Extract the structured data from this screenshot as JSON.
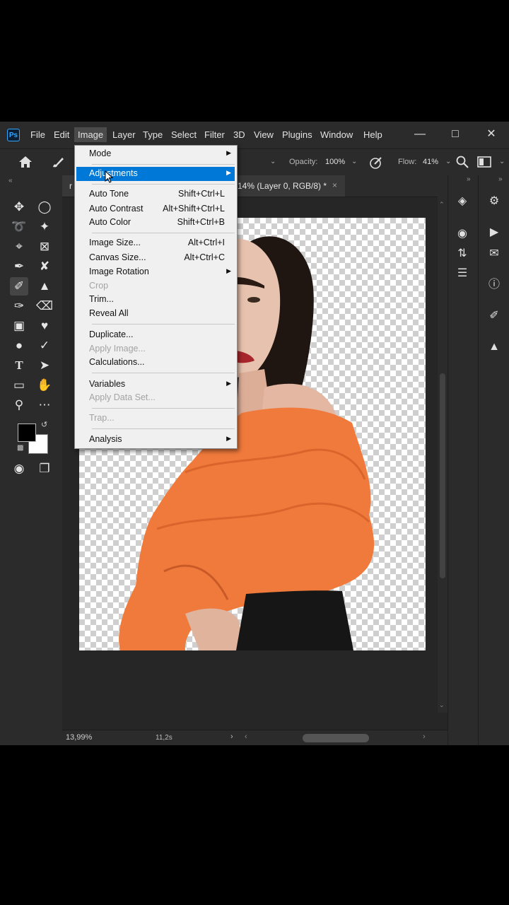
{
  "menubar": {
    "logo": "Ps",
    "items": [
      "File",
      "Edit",
      "Image",
      "Layer",
      "Type",
      "Select",
      "Filter",
      "3D",
      "View",
      "Plugins",
      "Window",
      "Help"
    ],
    "active": "Image"
  },
  "optionsbar": {
    "opacity_label": "Opacity:",
    "opacity_value": "100%",
    "flow_label": "Flow:",
    "flow_value": "41%"
  },
  "document": {
    "tab_prefix": "r",
    "tab_title": "14% (Layer 0, RGB/8) *",
    "close_glyph": "×"
  },
  "status": {
    "zoom": "13,99%",
    "timing": "11,2s"
  },
  "image_menu": {
    "items": [
      {
        "label": "Mode",
        "submenu": true
      },
      {
        "label": "Adjustments",
        "submenu": true,
        "highlighted": true
      },
      {
        "label": "Auto Tone",
        "shortcut": "Shift+Ctrl+L"
      },
      {
        "label": "Auto Contrast",
        "shortcut": "Alt+Shift+Ctrl+L"
      },
      {
        "label": "Auto Color",
        "shortcut": "Shift+Ctrl+B"
      },
      {
        "label": "Image Size...",
        "shortcut": "Alt+Ctrl+I"
      },
      {
        "label": "Canvas Size...",
        "shortcut": "Alt+Ctrl+C"
      },
      {
        "label": "Image Rotation",
        "submenu": true
      },
      {
        "label": "Crop",
        "disabled": true
      },
      {
        "label": "Trim..."
      },
      {
        "label": "Reveal All"
      },
      {
        "label": "Duplicate..."
      },
      {
        "label": "Apply Image...",
        "disabled": true
      },
      {
        "label": "Calculations..."
      },
      {
        "label": "Variables",
        "submenu": true
      },
      {
        "label": "Apply Data Set...",
        "disabled": true
      },
      {
        "label": "Trap...",
        "disabled": true
      },
      {
        "label": "Analysis",
        "submenu": true
      }
    ]
  },
  "colors": {
    "accent": "#0078d7",
    "foreground": "#000000",
    "background": "#ffffff",
    "blouse": "#f07a3c",
    "app_bg": "#2b2b2b"
  }
}
